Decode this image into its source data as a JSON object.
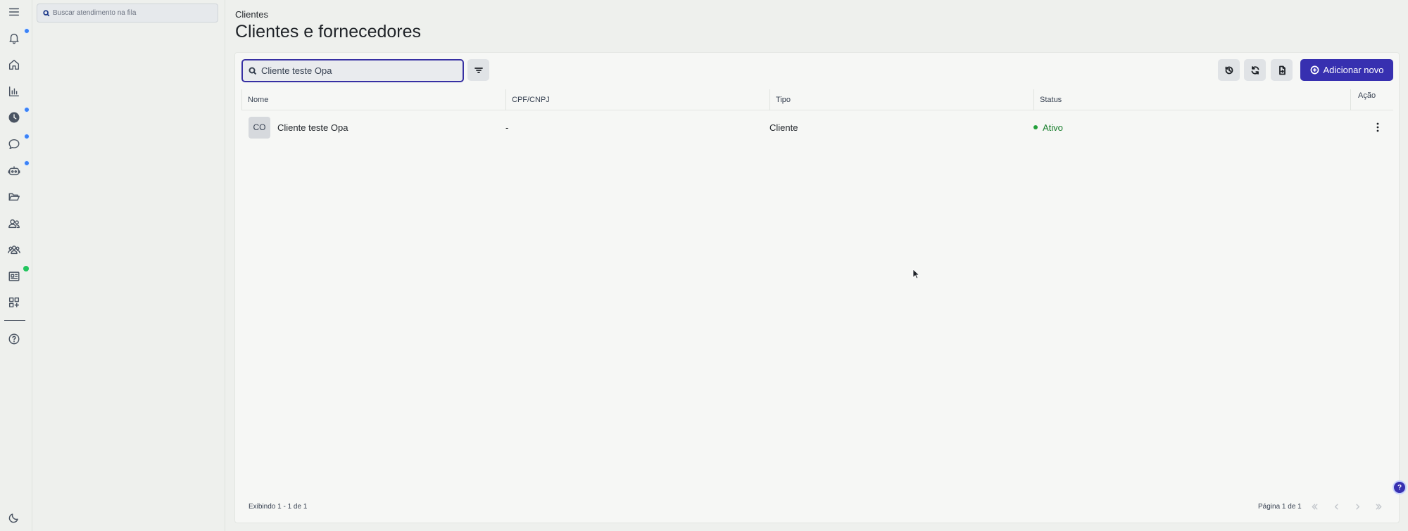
{
  "rail": {
    "items": [
      {
        "name": "menu-icon"
      },
      {
        "name": "bell-icon",
        "badge": "blue"
      },
      {
        "name": "home-icon"
      },
      {
        "name": "chart-icon"
      },
      {
        "name": "clock-icon",
        "badge": "blue"
      },
      {
        "name": "chat-icon",
        "badge": "blue"
      },
      {
        "name": "robot-icon",
        "badge": "blue"
      },
      {
        "name": "folder-icon"
      },
      {
        "name": "contacts-icon"
      },
      {
        "name": "users-icon"
      },
      {
        "name": "newspaper-icon",
        "badge": "green"
      },
      {
        "name": "apps-icon"
      },
      {
        "name": "help-circle-icon"
      },
      {
        "name": "moon-icon"
      }
    ],
    "colors": {
      "badge_blue": "#3b82f6",
      "badge_green": "#22c55e"
    }
  },
  "queue": {
    "search_placeholder": "Buscar atendimento na fila"
  },
  "header": {
    "breadcrumb": "Clientes",
    "title": "Clientes e fornecedores"
  },
  "toolbar": {
    "search_value": "Cliente teste Opa",
    "add_label": "Adicionar novo",
    "accent": "#3730b0"
  },
  "table": {
    "columns": [
      "Nome",
      "CPF/CNPJ",
      "Tipo",
      "Status",
      "Ação"
    ],
    "rows": [
      {
        "initials": "CO",
        "name": "Cliente teste Opa",
        "document": "-",
        "type": "Cliente",
        "status": "Ativo"
      }
    ]
  },
  "footer": {
    "count": "Exibindo 1 - 1 de 1",
    "page": "Página 1 de 1"
  },
  "help_fab": "?"
}
